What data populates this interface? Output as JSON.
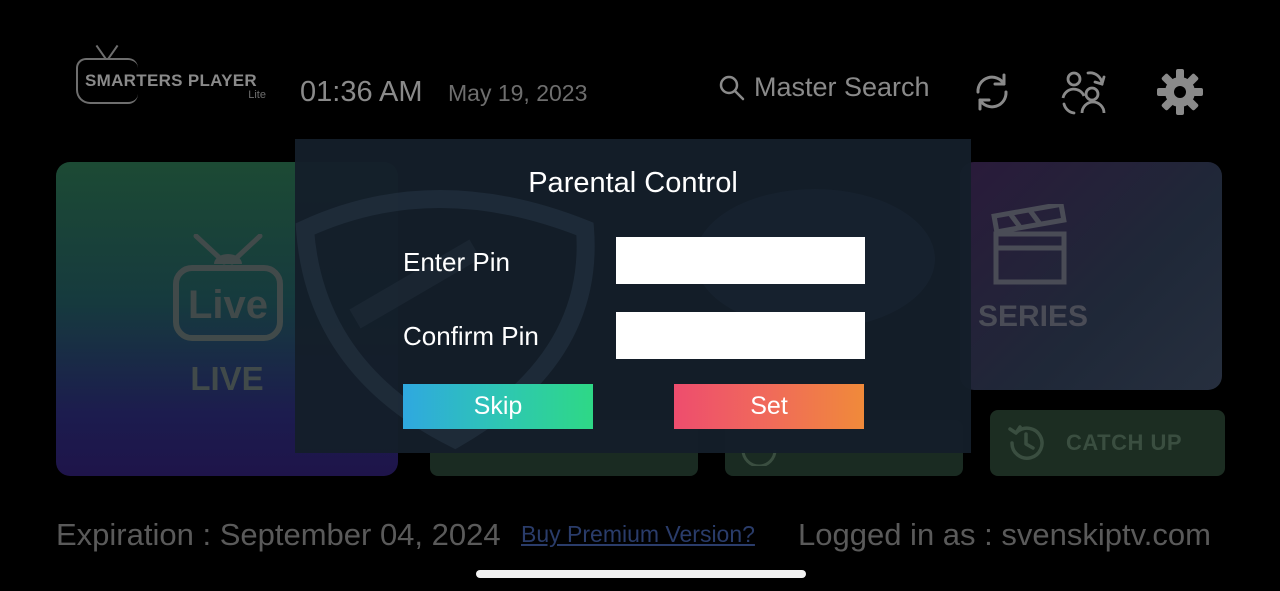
{
  "header": {
    "logo_text": "SMARTERS PLAYER",
    "logo_sub": "Lite",
    "time": "01:36 AM",
    "date": "May 19, 2023",
    "search_label": "Master Search"
  },
  "icons": {
    "search": "search-icon",
    "refresh": "refresh-icon",
    "switch_user": "switch-user-icon",
    "settings": "gear-icon"
  },
  "tiles": {
    "live": "LIVE",
    "series": "SERIES",
    "catch_up": "CATCH UP"
  },
  "modal": {
    "title": "Parental Control",
    "enter_pin_label": "Enter Pin",
    "confirm_pin_label": "Confirm Pin",
    "enter_pin_value": "",
    "confirm_pin_value": "",
    "skip_label": "Skip",
    "set_label": "Set"
  },
  "footer": {
    "expiration": "Expiration : September 04, 2024",
    "buy_premium": "Buy Premium Version?",
    "logged_in": "Logged in as : svenskiptv.com"
  },
  "colors": {
    "skip_start": "#2fa8e0",
    "skip_end": "#2ed886",
    "set_start": "#ee4d6e",
    "set_end": "#f08a3a",
    "modal_bg": "#141e2a"
  }
}
